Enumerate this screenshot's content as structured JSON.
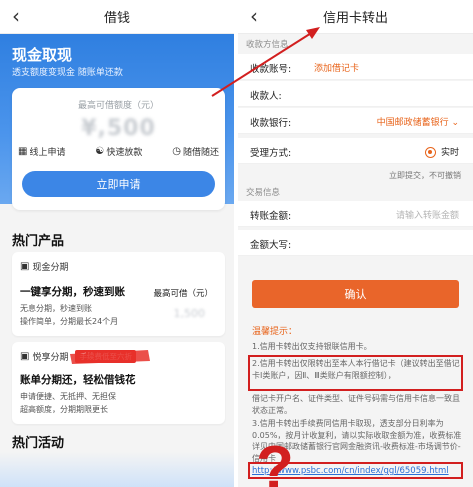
{
  "left": {
    "header": {
      "title": "借钱"
    },
    "hero": {
      "title": "现金取现",
      "subtitle": "透支额度变现金 随账单还款"
    },
    "limit_card": {
      "label": "最高可借额度（元）",
      "value": "¥,500",
      "features": [
        {
          "icon": "document-icon",
          "label": "线上申请"
        },
        {
          "icon": "yen-circle-icon",
          "label": "快速放款"
        },
        {
          "icon": "clock-icon",
          "label": "随借随还"
        }
      ],
      "apply_label": "立即申请"
    },
    "hot_products_title": "热门产品",
    "products": [
      {
        "tag": "现金分期",
        "headline": "一键享分期，秒速到账",
        "desc_lines": [
          "无息分期，秒速到账",
          "操作简单，分期最长24个月"
        ],
        "right_label": "最高可借（元）",
        "right_value": "1,500"
      },
      {
        "tag": "悦享分期",
        "promo": "手续费低至六折",
        "headline": "账单分期还，轻松借钱花",
        "desc_lines": [
          "申请便捷、无抵押、无担保",
          "超高额度，分期期限更长"
        ]
      }
    ],
    "hot_activity_title": "热门活动"
  },
  "right": {
    "header": {
      "title": "信用卡转出"
    },
    "payee_section": "收款方信息",
    "rows": {
      "account": {
        "label": "收款账号:",
        "value": "添加借记卡"
      },
      "payee": {
        "label": "收款人:"
      },
      "bank": {
        "label": "收款银行:",
        "value": "中国邮政储蓄银行"
      },
      "method": {
        "label": "受理方式:",
        "value": "实时"
      }
    },
    "method_note": "立即提交，不可撤销",
    "trade_section": "交易信息",
    "amount": {
      "label": "转账金额:",
      "placeholder": "请输入转账金额"
    },
    "amount_upper": {
      "label": "金额大写:"
    },
    "confirm_label": "确认",
    "tips_title": "温馨提示：",
    "tips": [
      "1.信用卡转出仅支持银联信用卡。",
      "2.信用卡转出仅限转出至本人本行借记卡（建议转出至借记卡Ⅰ类账户，因Ⅱ、Ⅲ类账户有限额控制），",
      "借记卡开户名、证件类型、证件号码需与信用卡信息一致且状态正常。",
      "3.信用卡转出手续费同信用卡取现，透支部分日利率为0.05%，按月计收复利，请以实际收取金额为准，收费标准详见中国邮政储蓄银行官网金融资讯-收费标准-市场调节价-信用卡"
    ],
    "link": "http://www.psbc.com/cn/index/ggl/65059.html"
  },
  "annotation": {
    "question_mark": "?",
    "colors": {
      "accent_red": "#d21f1f",
      "accent_orange": "#e8641b",
      "accent_blue": "#3c86e6"
    }
  }
}
